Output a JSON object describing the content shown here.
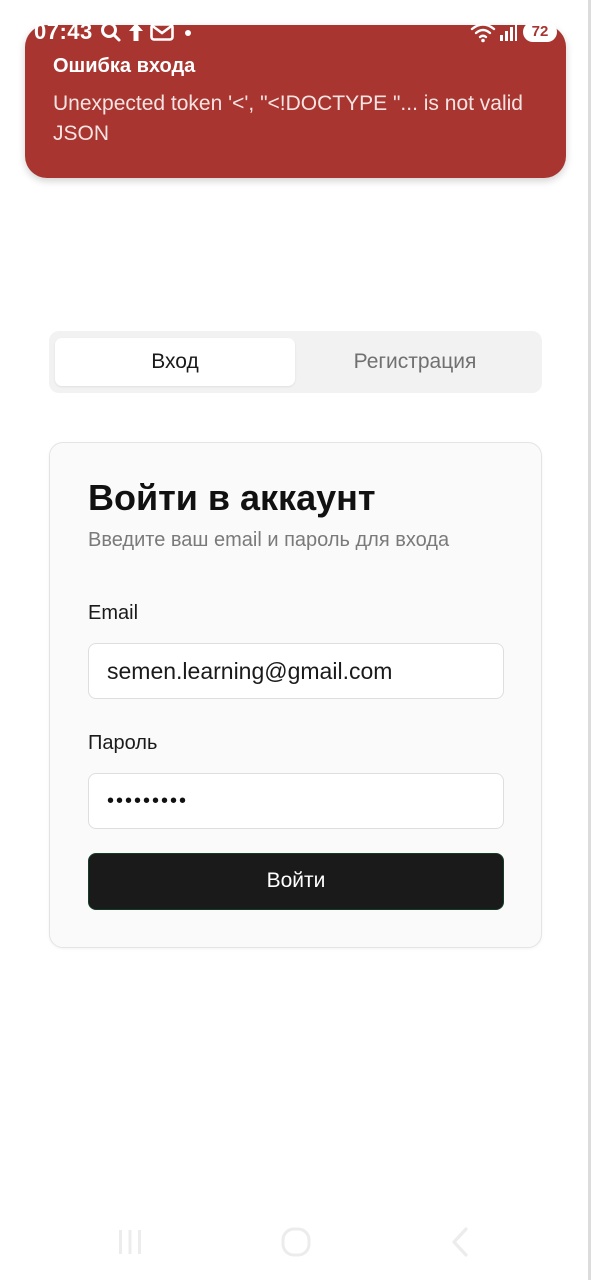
{
  "status_bar": {
    "time": "07:43",
    "battery": "72",
    "left_icons": [
      "search-icon",
      "upload-icon",
      "mail-icon",
      "dot-icon"
    ],
    "right_icons": [
      "wifi-icon",
      "signal-icon",
      "battery-icon"
    ]
  },
  "toast": {
    "title": "Ошибка входа",
    "message": "Unexpected token '<', \"<!DOCTYPE \"... is not valid JSON",
    "background": "#a83530"
  },
  "tabs": {
    "login": "Вход",
    "register": "Регистрация",
    "active": "login"
  },
  "card": {
    "title": "Войти в аккаунт",
    "subtitle": "Введите ваш email и пароль для входа",
    "email_label": "Email",
    "email_value": "semen.learning@gmail.com",
    "password_label": "Пароль",
    "password_value": "•••••••••",
    "submit_label": "Войти"
  },
  "nav_bar": {
    "buttons": [
      "recents-icon",
      "home-icon",
      "back-icon"
    ]
  }
}
